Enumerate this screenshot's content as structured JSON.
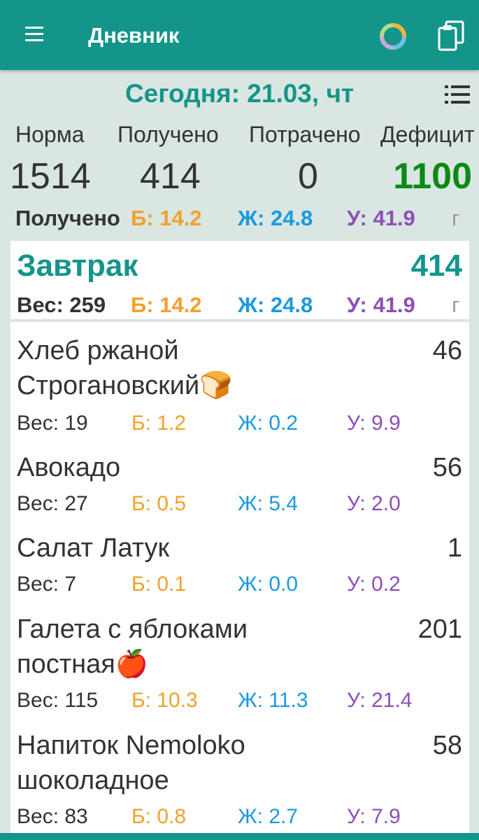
{
  "app": {
    "title": "Дневник"
  },
  "date_title": "Сегодня: 21.03, чт",
  "summary": {
    "labels": [
      "Норма",
      "Получено",
      "Потрачено",
      "Дефицит"
    ],
    "values": [
      "1514",
      "414",
      "0",
      "1100"
    ]
  },
  "macros_total": {
    "label": "Получено",
    "b": "Б: 14.2",
    "zh": "Ж: 24.8",
    "u": "У: 41.9",
    "unit": "г"
  },
  "meal": {
    "title": "Завтрак",
    "total": "414",
    "weight": "Вес: 259",
    "b": "Б: 14.2",
    "zh": "Ж: 24.8",
    "u": "У: 41.9",
    "unit": "г"
  },
  "foods": [
    {
      "name": [
        "Хлеб ржаной",
        "Строгановский🍞"
      ],
      "cal": "46",
      "weight": "Вес: 19",
      "b": "Б: 1.2",
      "zh": "Ж: 0.2",
      "u": "У: 9.9"
    },
    {
      "name": [
        "Авокадо"
      ],
      "cal": "56",
      "weight": "Вес: 27",
      "b": "Б: 0.5",
      "zh": "Ж: 5.4",
      "u": "У: 2.0"
    },
    {
      "name": [
        "Салат Латук"
      ],
      "cal": "1",
      "weight": "Вес: 7",
      "b": "Б: 0.1",
      "zh": "Ж: 0.0",
      "u": "У: 0.2"
    },
    {
      "name": [
        "Галета с яблоками",
        "постная🍎"
      ],
      "cal": "201",
      "weight": "Вес: 115",
      "b": "Б: 10.3",
      "zh": "Ж: 11.3",
      "u": "У: 21.4"
    },
    {
      "name": [
        "Напиток Nemoloko",
        "шоколадное"
      ],
      "cal": "58",
      "weight": "Вес: 83",
      "b": "Б: 0.8",
      "zh": "Ж: 2.7",
      "u": "У: 7.9"
    }
  ],
  "colors": {
    "primary": "#14958a",
    "deficit": "#0a8a14",
    "protein": "#f2a12b",
    "fat": "#1b99e0",
    "carbs": "#8e4fb8"
  },
  "icons": [
    "menu-icon",
    "progress-ring-icon",
    "clipboard-icon",
    "list-icon"
  ]
}
